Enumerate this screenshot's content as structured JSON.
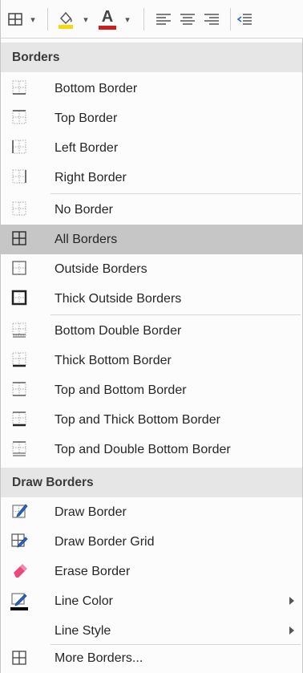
{
  "sections": {
    "borders": "Borders",
    "draw_borders": "Draw Borders"
  },
  "items": {
    "bottom_border": "Bottom Border",
    "top_border": "Top Border",
    "left_border": "Left Border",
    "right_border": "Right Border",
    "no_border": "No Border",
    "all_borders": "All Borders",
    "outside_borders": "Outside Borders",
    "thick_outside_borders": "Thick Outside Borders",
    "bottom_double_border": "Bottom Double Border",
    "thick_bottom_border": "Thick Bottom Border",
    "top_and_bottom_border": "Top and Bottom Border",
    "top_and_thick_bottom_border": "Top and Thick Bottom Border",
    "top_and_double_bottom_border": "Top and Double Bottom Border",
    "draw_border": "Draw Border",
    "draw_border_grid": "Draw Border Grid",
    "erase_border": "Erase Border",
    "line_color": "Line Color",
    "line_style": "Line Style",
    "more_borders": "More Borders..."
  },
  "toolbar": {
    "font_color_letter": "A"
  },
  "colors": {
    "fill_highlight": "#f5d90a",
    "font_color_bar": "#d01c1c",
    "line_color_bar": "#000000",
    "pen_blue": "#2a63b8",
    "eraser_pink": "#e94a7a",
    "selected_row": "#c6c6c6"
  },
  "icons": {
    "borders_dropdown": "table-borders-icon",
    "fill_color": "paint-bucket-icon",
    "font_color": "font-color-icon",
    "align_left": "align-left-icon",
    "align_center": "align-center-icon",
    "align_right": "align-right-icon",
    "indent": "decrease-indent-icon"
  },
  "selected_item": "All Borders"
}
